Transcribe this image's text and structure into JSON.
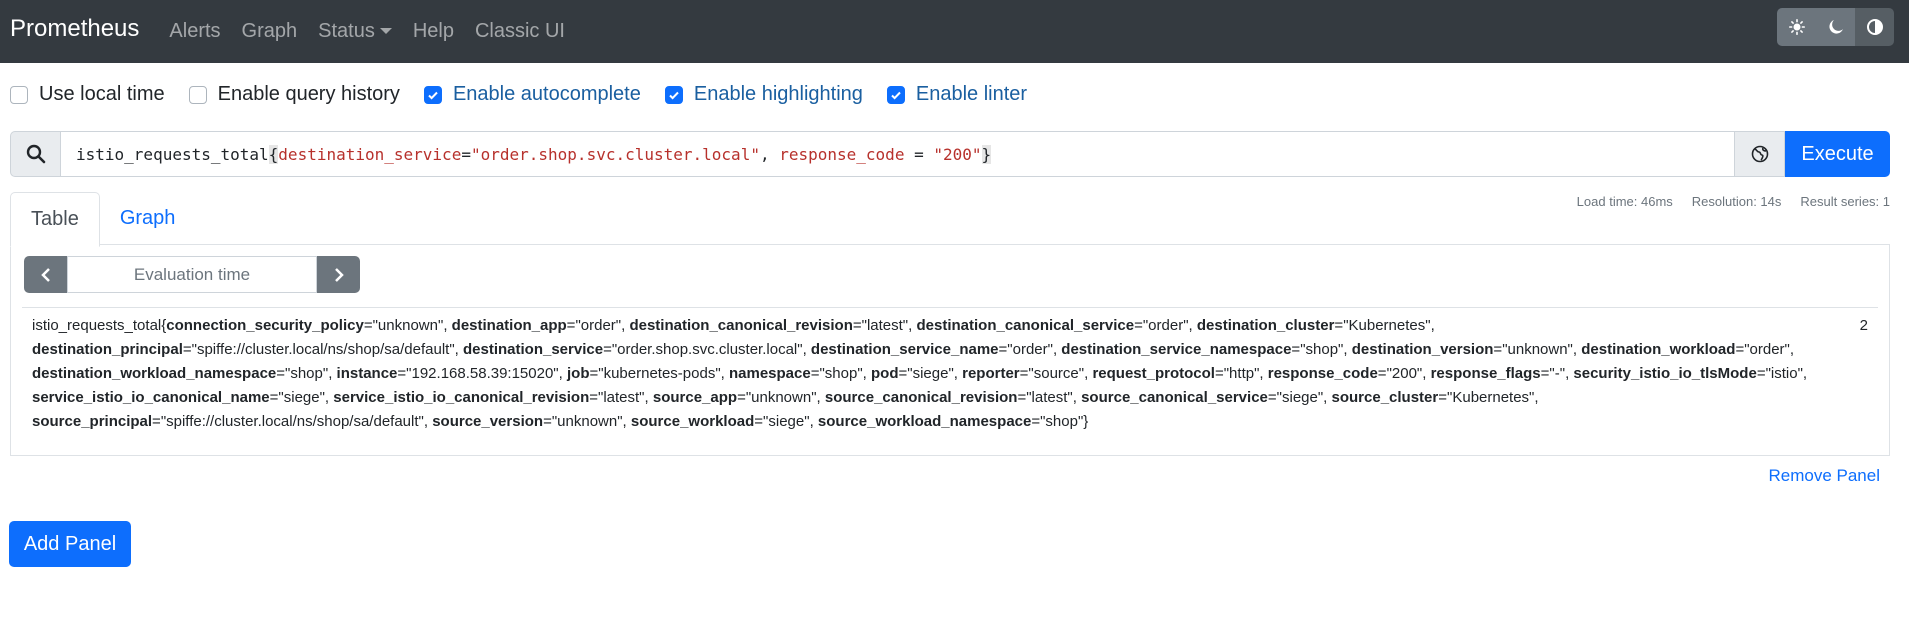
{
  "navbar": {
    "brand": "Prometheus",
    "links": [
      "Alerts",
      "Graph",
      "Status",
      "Help",
      "Classic UI"
    ],
    "theme_icons": [
      "sun-icon",
      "moon-icon",
      "half-circle-icon"
    ]
  },
  "options": [
    {
      "label": "Use local time",
      "checked": false
    },
    {
      "label": "Enable query history",
      "checked": false
    },
    {
      "label": "Enable autocomplete",
      "checked": true
    },
    {
      "label": "Enable highlighting",
      "checked": true
    },
    {
      "label": "Enable linter",
      "checked": true
    }
  ],
  "query": {
    "metric": "istio_requests_total",
    "open_brace": "{",
    "label1": "destination_service",
    "op1": "=",
    "value1": "\"order.shop.svc.cluster.local\"",
    "sep": ", ",
    "label2": "response_code",
    "op2": " = ",
    "value2": "\"200\"",
    "close_brace": "}",
    "execute_label": "Execute"
  },
  "stats": {
    "load_time": "Load time: 46ms",
    "resolution": "Resolution: 14s",
    "result_series": "Result series: 1"
  },
  "tabs": [
    "Table",
    "Graph"
  ],
  "eval_placeholder": "Evaluation time",
  "result": {
    "metric": "istio_requests_total",
    "labels": [
      {
        "k": "connection_security_policy",
        "v": "\"unknown\""
      },
      {
        "k": "destination_app",
        "v": "\"order\""
      },
      {
        "k": "destination_canonical_revision",
        "v": "\"latest\""
      },
      {
        "k": "destination_canonical_service",
        "v": "\"order\""
      },
      {
        "k": "destination_cluster",
        "v": "\"Kubernetes\""
      },
      {
        "k": "destination_principal",
        "v": "\"spiffe://cluster.local/ns/shop/sa/default\""
      },
      {
        "k": "destination_service",
        "v": "\"order.shop.svc.cluster.local\""
      },
      {
        "k": "destination_service_name",
        "v": "\"order\""
      },
      {
        "k": "destination_service_namespace",
        "v": "\"shop\""
      },
      {
        "k": "destination_version",
        "v": "\"unknown\""
      },
      {
        "k": "destination_workload",
        "v": "\"order\""
      },
      {
        "k": "destination_workload_namespace",
        "v": "\"shop\""
      },
      {
        "k": "instance",
        "v": "\"192.168.58.39:15020\""
      },
      {
        "k": "job",
        "v": "\"kubernetes-pods\""
      },
      {
        "k": "namespace",
        "v": "\"shop\""
      },
      {
        "k": "pod",
        "v": "\"siege\""
      },
      {
        "k": "reporter",
        "v": "\"source\""
      },
      {
        "k": "request_protocol",
        "v": "\"http\""
      },
      {
        "k": "response_code",
        "v": "\"200\""
      },
      {
        "k": "response_flags",
        "v": "\"-\""
      },
      {
        "k": "security_istio_io_tlsMode",
        "v": "\"istio\""
      },
      {
        "k": "service_istio_io_canonical_name",
        "v": "\"siege\""
      },
      {
        "k": "service_istio_io_canonical_revision",
        "v": "\"latest\""
      },
      {
        "k": "source_app",
        "v": "\"unknown\""
      },
      {
        "k": "source_canonical_revision",
        "v": "\"latest\""
      },
      {
        "k": "source_canonical_service",
        "v": "\"siege\""
      },
      {
        "k": "source_cluster",
        "v": "\"Kubernetes\""
      },
      {
        "k": "source_principal",
        "v": "\"spiffe://cluster.local/ns/shop/sa/default\""
      },
      {
        "k": "source_version",
        "v": "\"unknown\""
      },
      {
        "k": "source_workload",
        "v": "\"siege\""
      },
      {
        "k": "source_workload_namespace",
        "v": "\"shop\""
      }
    ],
    "value": "2"
  },
  "remove_panel": "Remove Panel",
  "add_panel": "Add Panel"
}
